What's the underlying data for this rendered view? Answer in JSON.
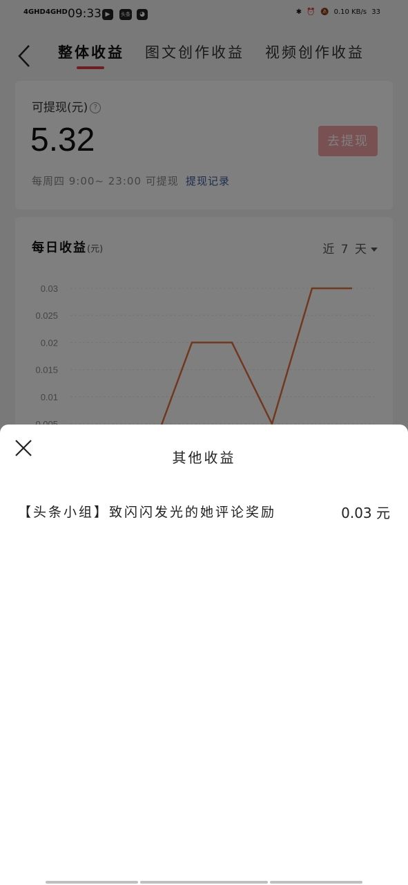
{
  "status_bar": {
    "signal1": "4GHD",
    "signal2": "4GHD",
    "time": "09:33",
    "app_icon_text": "头条",
    "net_speed": "0.10 KB/s",
    "battery": "33"
  },
  "header": {
    "tabs": [
      {
        "label": "整体收益",
        "active": true
      },
      {
        "label": "图文创作收益",
        "active": false
      },
      {
        "label": "视频创作收益",
        "active": false
      }
    ]
  },
  "withdraw_card": {
    "label": "可提现(元)",
    "amount": "5.32",
    "button": "去提现",
    "schedule": "每周四 9:00~ 23:00 可提现",
    "records_link": "提现记录"
  },
  "daily_card": {
    "title": "每日收益",
    "unit": "(元)",
    "range": "近 7 天"
  },
  "chart_data": {
    "type": "line",
    "title": "",
    "xlabel": "",
    "ylabel": "",
    "y_ticks": [
      "0.03",
      "0.025",
      "0.02",
      "0.015",
      "0.01",
      "0.005"
    ],
    "ylim": [
      0,
      0.03
    ],
    "x": [
      1,
      2,
      3,
      4,
      5,
      6,
      7
    ],
    "series": [
      {
        "values": [
          0,
          0,
          0.02,
          0.02,
          0.005,
          0.03,
          0.03
        ],
        "color": "#e0703a"
      }
    ],
    "grid": true,
    "partially_hidden": true
  },
  "sheet": {
    "title": "其他收益",
    "items": [
      {
        "title": "【头条小组】致闪闪发光的她评论奖励",
        "amount": "0.03 元"
      }
    ]
  },
  "colors": {
    "accent": "#e13a45",
    "link": "#3a5c9a",
    "line": "#e0703a"
  }
}
